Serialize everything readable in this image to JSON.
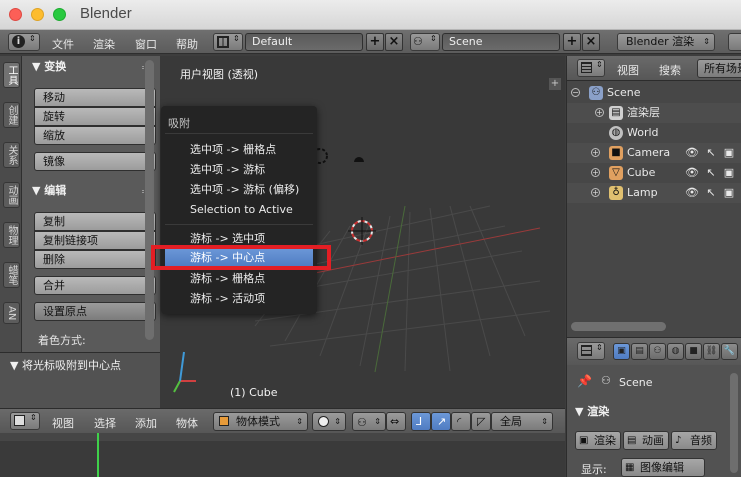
{
  "window": {
    "title": "Blender"
  },
  "topbar": {
    "info_icon": "info-icon",
    "menus": [
      "文件",
      "渲染",
      "窗口",
      "帮助"
    ],
    "screen_layout": "Default",
    "scene": "Scene",
    "render_engine": "Blender 渲染"
  },
  "toolshelf": {
    "tabs": [
      "工具",
      "创建",
      "关系",
      "动画",
      "物理",
      "蜡笔",
      "AN"
    ],
    "transform_header": "变换",
    "transform_buttons": [
      "移动",
      "旋转",
      "缩放"
    ],
    "mirror_button": "镜像",
    "edit_header": "编辑",
    "edit_buttons": [
      "复制",
      "复制链接项",
      "删除"
    ],
    "join_button": "合并",
    "origin_dropdown": "设置原点",
    "shading_label": "着色方式:",
    "last_operator": "将光标吸附到中心点"
  },
  "viewport": {
    "title": "用户视图 (透视)",
    "object_label": "(1) Cube",
    "snap_menu": {
      "title": "吸附",
      "items": [
        "选中项 -> 栅格点",
        "选中项 -> 游标",
        "选中项 -> 游标 (偏移)",
        "Selection to Active"
      ],
      "items2": [
        "游标 -> 选中项",
        "游标 -> 中心点",
        "游标 -> 栅格点",
        "游标 -> 活动项"
      ],
      "highlighted": "游标 -> 中心点"
    }
  },
  "viewport_header": {
    "menus": [
      "视图",
      "选择",
      "添加",
      "物体"
    ],
    "mode": "物体模式",
    "orientation": "全局"
  },
  "outliner": {
    "header_menus": [
      "视图",
      "搜索"
    ],
    "filter": "所有场景",
    "rows": [
      {
        "label": "Scene",
        "icon": "scene-icon"
      },
      {
        "label": "渲染层",
        "icon": "render-layers-icon"
      },
      {
        "label": "World",
        "icon": "world-icon"
      },
      {
        "label": "Camera",
        "icon": "camera-icon"
      },
      {
        "label": "Cube",
        "icon": "mesh-icon"
      },
      {
        "label": "Lamp",
        "icon": "lamp-icon"
      }
    ]
  },
  "properties": {
    "scene_label": "Scene",
    "render_header": "渲染",
    "render_buttons": [
      "渲染",
      "动画",
      "音频"
    ],
    "display_label": "显示:",
    "display_value": "图像编辑"
  },
  "colors": {
    "highlight": "#5a87cc",
    "annotation_red": "#e31e24",
    "current_frame": "#3fd04a"
  }
}
